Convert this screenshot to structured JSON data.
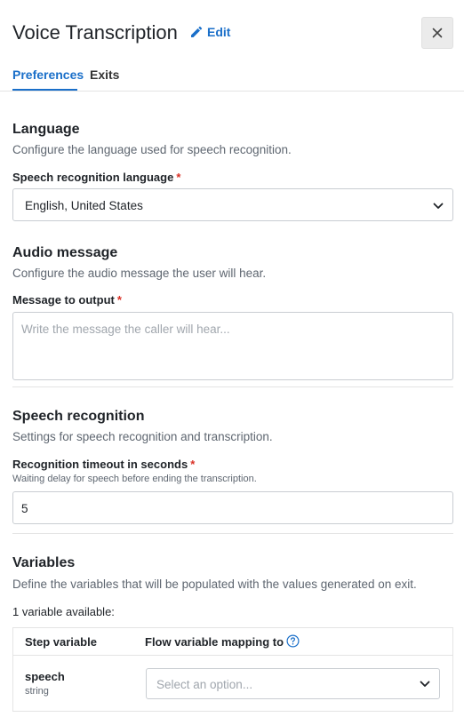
{
  "header": {
    "title": "Voice Transcription",
    "edit_label": "Edit"
  },
  "tabs": [
    {
      "label": "Preferences",
      "active": true
    },
    {
      "label": "Exits",
      "active": false
    }
  ],
  "language": {
    "title": "Language",
    "description": "Configure the language used for speech recognition.",
    "field_label": "Speech recognition language",
    "required_mark": "*",
    "selected_value": "English, United States"
  },
  "audio": {
    "title": "Audio message",
    "description": "Configure the audio message the user will hear.",
    "field_label": "Message to output",
    "required_mark": "*",
    "placeholder": "Write the message the caller will hear..."
  },
  "speech": {
    "title": "Speech recognition",
    "description": "Settings for speech recognition and transcription.",
    "field_label": "Recognition timeout in seconds",
    "required_mark": "*",
    "hint": "Waiting delay for speech before ending the transcription.",
    "value": "5"
  },
  "variables": {
    "title": "Variables",
    "description": "Define the variables that will be populated with the values generated on exit.",
    "count_text": "1 variable available:",
    "col_step": "Step variable",
    "col_flow": "Flow variable mapping to",
    "rows": [
      {
        "name": "speech",
        "type": "string",
        "placeholder": "Select an option..."
      }
    ]
  },
  "colors": {
    "accent": "#1a6fc9",
    "required": "#d93025"
  },
  "icons": {
    "edit": "pencil-icon",
    "close": "close-icon",
    "dropdown": "chevron-down-icon",
    "help": "help-circle-icon"
  }
}
